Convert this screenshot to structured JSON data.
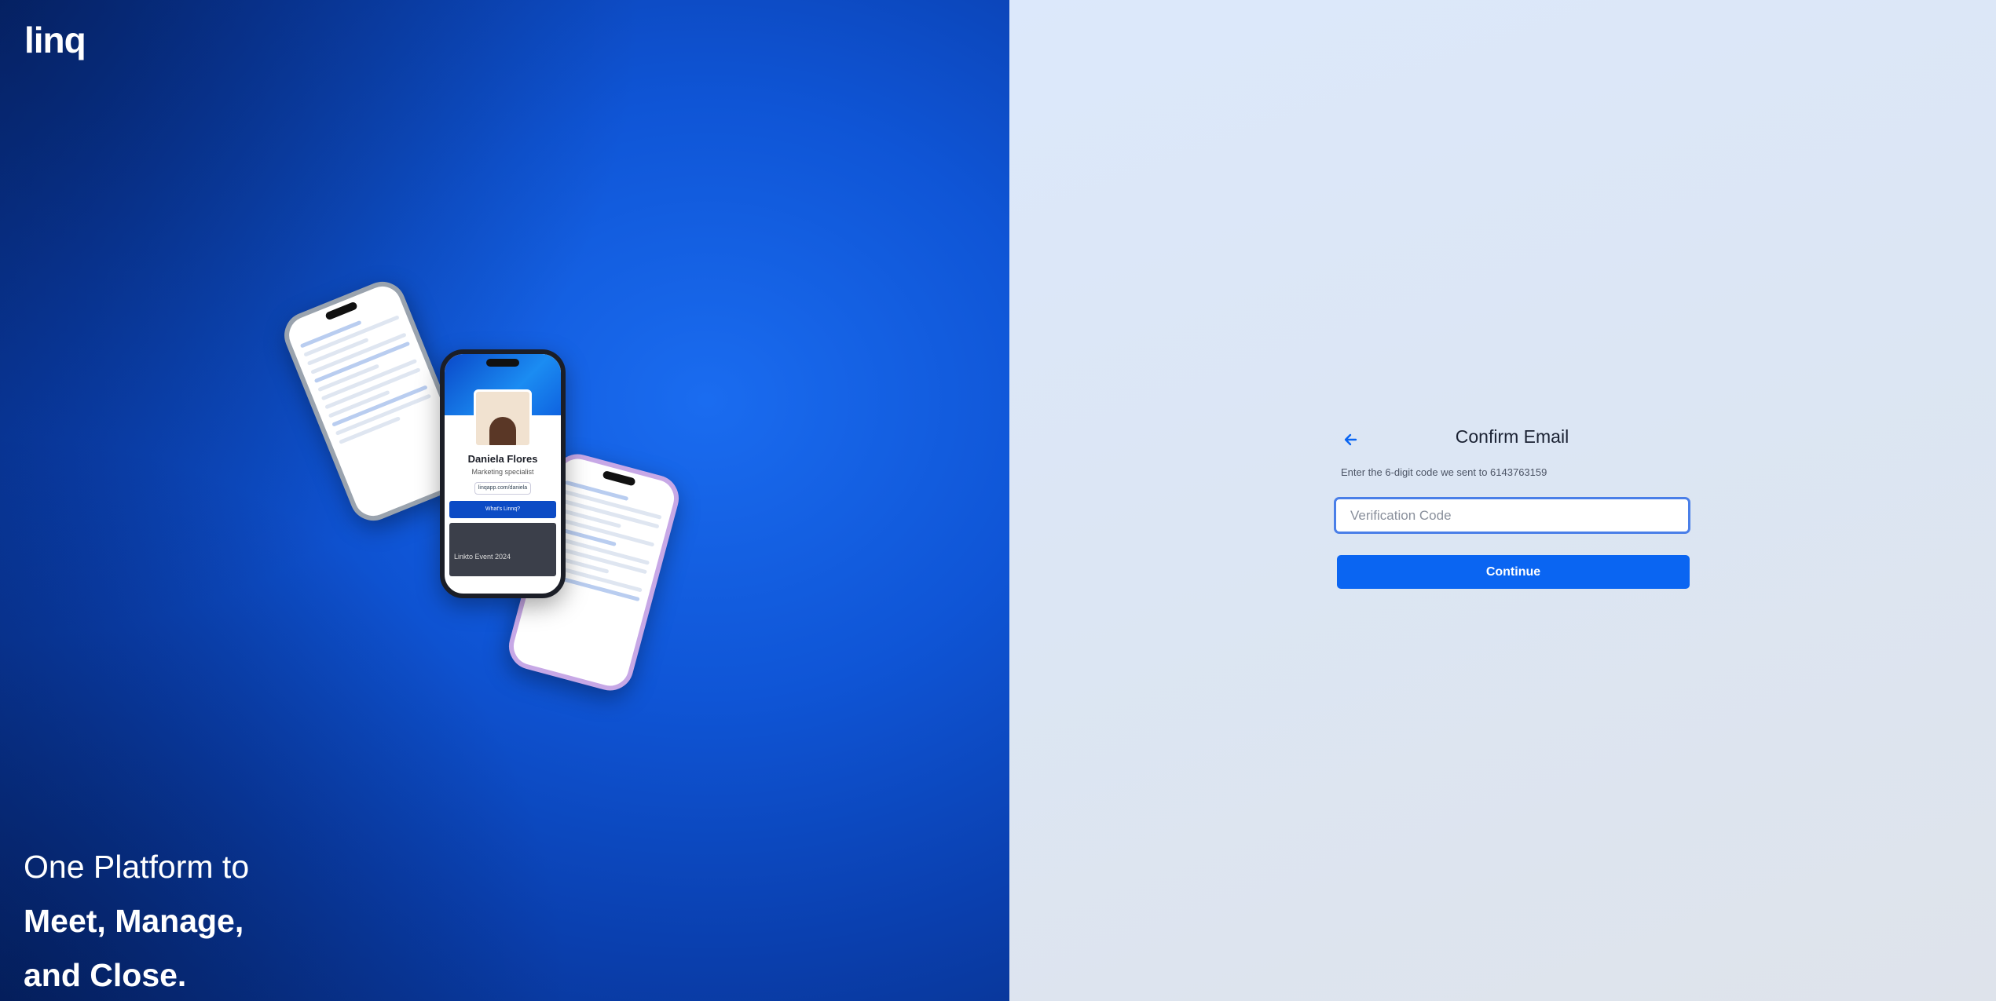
{
  "brand": {
    "logo_text": "linq"
  },
  "hero": {
    "tagline_line1": "One Platform to",
    "tagline_line2": "Meet, Manage,",
    "tagline_line3": "and Close.",
    "phone_profile": {
      "name": "Daniela Flores",
      "role": "Marketing specialist",
      "link": "linqapp.com/daniela",
      "button": "What's Linnq?",
      "video_caption": "Linkto Event 2024"
    }
  },
  "form": {
    "title": "Confirm Email",
    "subtitle": "Enter the 6-digit code we sent to 6143763159",
    "code_placeholder": "Verification Code",
    "code_value": "",
    "continue_label": "Continue",
    "back_icon": "arrow-left-icon"
  },
  "colors": {
    "accent": "#0a65f2",
    "hero_blue": "#0f55d6",
    "input_border": "#4a7fe8"
  }
}
